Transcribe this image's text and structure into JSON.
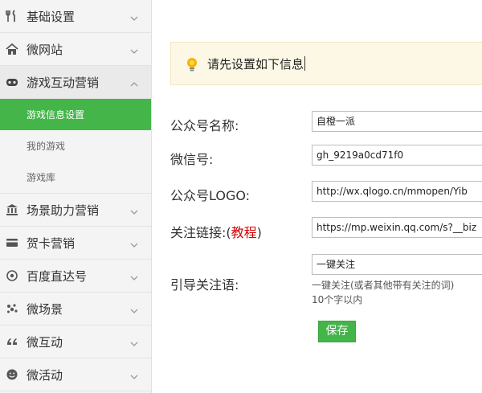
{
  "sidebar": {
    "items": [
      {
        "label": "基础设置",
        "icon": "wrench-fork-icon"
      },
      {
        "label": "微网站",
        "icon": "home-icon"
      },
      {
        "label": "游戏互动营销",
        "icon": "gamepad-icon",
        "expanded": true,
        "children": [
          {
            "label": "游戏信息设置",
            "active": true
          },
          {
            "label": "我的游戏"
          },
          {
            "label": "游戏库"
          }
        ]
      },
      {
        "label": "场景助力营销",
        "icon": "bank-icon"
      },
      {
        "label": "贺卡营销",
        "icon": "card-icon"
      },
      {
        "label": "百度直达号",
        "icon": "target-icon"
      },
      {
        "label": "微场景",
        "icon": "scatter-icon"
      },
      {
        "label": "微互动",
        "icon": "quote-icon"
      },
      {
        "label": "微活动",
        "icon": "smiley-icon"
      }
    ]
  },
  "main": {
    "alert": {
      "text": "请先设置如下信息"
    },
    "form": {
      "name": {
        "label": "公众号名称:",
        "value": "自橙一派"
      },
      "wechat_id": {
        "label": "微信号:",
        "value": "gh_9219a0cd71f0"
      },
      "logo": {
        "label": "公众号LOGO:",
        "value": "http://wx.qlogo.cn/mmopen/Yib"
      },
      "follow_link": {
        "label_prefix": "关注链接:(",
        "label_link": "教程",
        "label_suffix": ")",
        "value": "https://mp.weixin.qq.com/s?__biz"
      },
      "guide": {
        "label": "引导关注语:",
        "value": "一键关注",
        "hint1": "一键关注(或者其他带有关注的词)",
        "hint2": "10个字以内"
      },
      "save_label": "保存"
    }
  },
  "colors": {
    "accent": "#44b549",
    "alert_bg": "#fdf8e6",
    "link_red": "#d90000"
  }
}
